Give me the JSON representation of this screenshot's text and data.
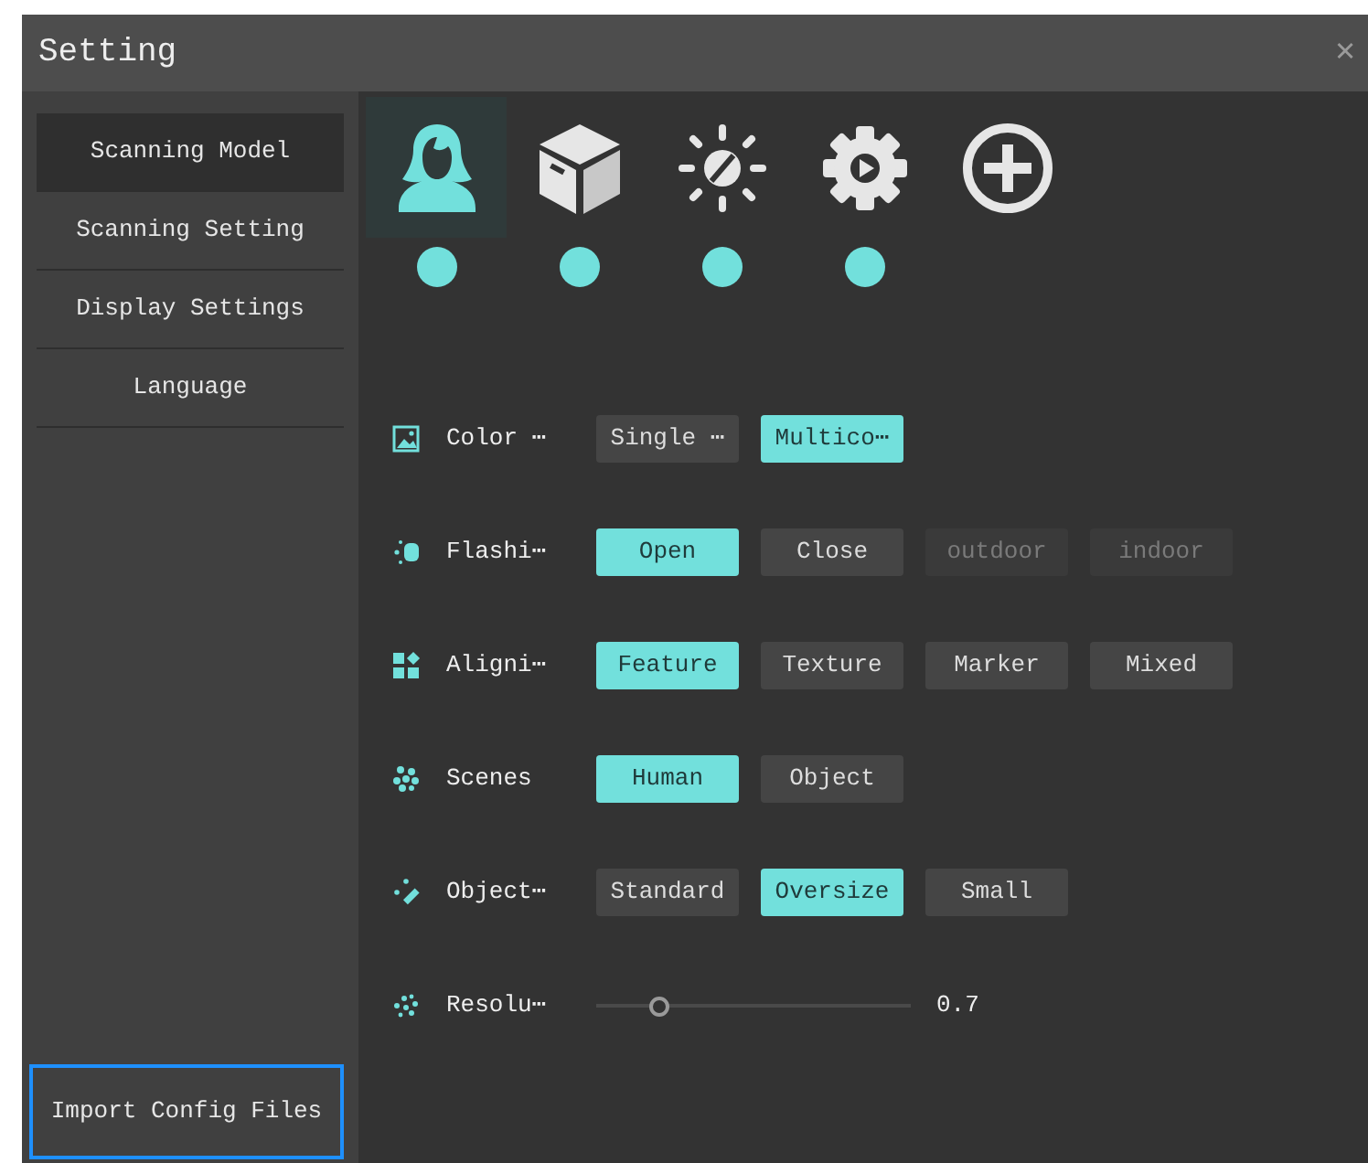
{
  "window": {
    "title": "Setting",
    "close": "✕"
  },
  "sidebar": {
    "items": [
      {
        "label": "Scanning Model",
        "selected": true
      },
      {
        "label": "Scanning Setting",
        "selected": false
      },
      {
        "label": "Display Settings",
        "selected": false
      },
      {
        "label": "Language",
        "selected": false
      }
    ],
    "import_button": "Import Config Files"
  },
  "modes": [
    {
      "kind": "person",
      "selected": true
    },
    {
      "kind": "box",
      "selected": false
    },
    {
      "kind": "light",
      "selected": false
    },
    {
      "kind": "gear",
      "selected": false
    },
    {
      "kind": "add",
      "selected": false
    }
  ],
  "settings": [
    {
      "kind": "options",
      "label": "Color ⋯",
      "options": [
        {
          "label": "Single ⋯",
          "selected": false,
          "disabled": false
        },
        {
          "label": "Multico⋯",
          "selected": true,
          "disabled": false
        }
      ]
    },
    {
      "kind": "options",
      "label": "Flashi⋯",
      "options": [
        {
          "label": "Open",
          "selected": true,
          "disabled": false
        },
        {
          "label": "Close",
          "selected": false,
          "disabled": false
        },
        {
          "label": "outdoor",
          "selected": false,
          "disabled": true
        },
        {
          "label": "indoor",
          "selected": false,
          "disabled": true
        }
      ]
    },
    {
      "kind": "options",
      "label": "Aligni⋯",
      "options": [
        {
          "label": "Feature",
          "selected": true,
          "disabled": false
        },
        {
          "label": "Texture",
          "selected": false,
          "disabled": false
        },
        {
          "label": "Marker",
          "selected": false,
          "disabled": false
        },
        {
          "label": "Mixed",
          "selected": false,
          "disabled": false
        }
      ]
    },
    {
      "kind": "options",
      "label": "Scenes",
      "options": [
        {
          "label": "Human",
          "selected": true,
          "disabled": false
        },
        {
          "label": "Object",
          "selected": false,
          "disabled": false
        }
      ]
    },
    {
      "kind": "options",
      "label": "Object⋯",
      "options": [
        {
          "label": "Standard",
          "selected": false,
          "disabled": false
        },
        {
          "label": "Oversize",
          "selected": true,
          "disabled": false
        },
        {
          "label": "Small",
          "selected": false,
          "disabled": false
        }
      ]
    },
    {
      "kind": "slider",
      "label": "Resolu⋯",
      "level": 0.2,
      "reading": "0.7"
    }
  ]
}
